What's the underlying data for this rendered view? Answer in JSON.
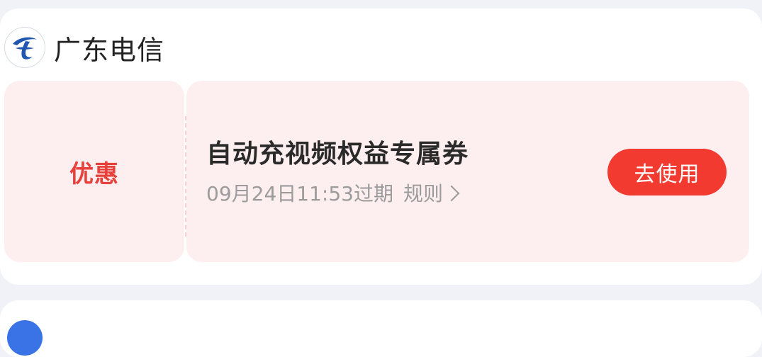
{
  "provider": {
    "name": "广东电信",
    "logo_icon": "china-telecom-logo-icon",
    "logo_color": "#1f57b0"
  },
  "coupon": {
    "type_label": "优惠",
    "title": "自动充视频权益专属券",
    "expiry": "09月24日11:53过期",
    "rules_label": "规则",
    "use_button_label": "去使用",
    "accent_color": "#f23a30",
    "background_color": "#fdeef0"
  }
}
